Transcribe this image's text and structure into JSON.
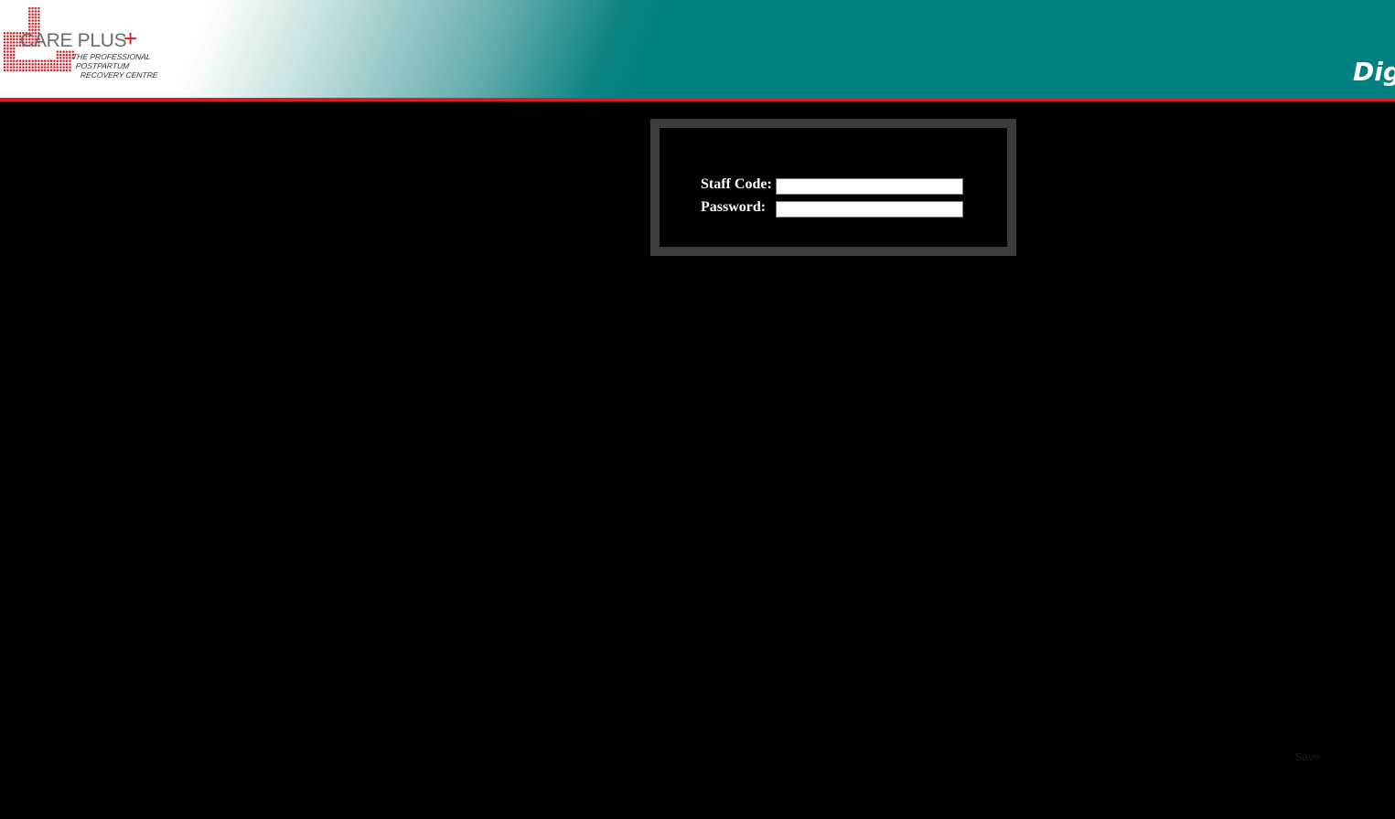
{
  "header": {
    "logo_name": "CARE PLUS",
    "logo_plus": "+",
    "logo_tagline": [
      "THE PROFESSIONAL",
      "POSTPARTUM",
      "RECOVERY CENTRE"
    ],
    "title": "Dig",
    "colors": {
      "teal": "#008080",
      "accent_red": "#d81f26"
    }
  },
  "login": {
    "staff_code_label": "Staff Code:",
    "staff_code_value": "",
    "password_label": "Password:",
    "password_value": ""
  },
  "footer": {
    "save_label": "Save"
  }
}
